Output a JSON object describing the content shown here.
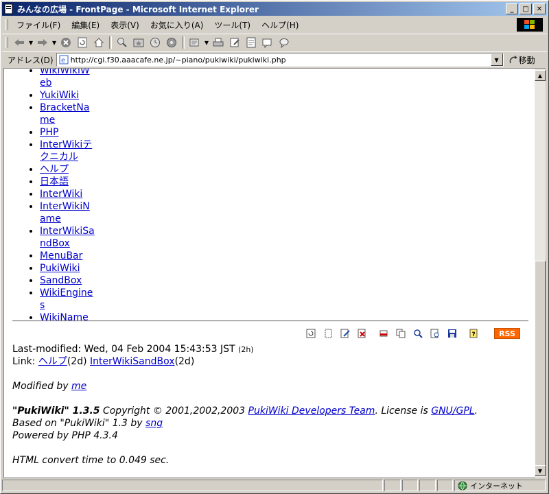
{
  "window": {
    "title": "みんなの広場 - FrontPage - Microsoft Internet Explorer"
  },
  "menu": {
    "items": [
      "ファイル(F)",
      "編集(E)",
      "表示(V)",
      "お気に入り(A)",
      "ツール(T)",
      "ヘルプ(H)"
    ]
  },
  "toolbar": {
    "buttons": [
      "back-icon",
      "forward-icon",
      "stop-icon",
      "refresh-icon",
      "home-icon",
      "search-icon",
      "favorites-icon",
      "history-icon",
      "mail-icon",
      "print-icon",
      "edit-icon",
      "discuss-icon",
      "messenger-icon"
    ]
  },
  "address": {
    "label": "アドレス(D)",
    "url": "http://cgi.f30.aaacafe.ne.jp/~piano/pukiwiki/pukiwiki.php",
    "go_label": "移動"
  },
  "page": {
    "links": [
      "WikiWikiWeb",
      "YukiWiki",
      "BracketName",
      "PHP",
      "InterWikiテクニカル",
      "ヘルプ",
      "日本語",
      "InterWiki",
      "InterWikiName",
      "InterWikiSandBox",
      "MenuBar",
      "PukiWiki",
      "SandBox",
      "WikiEngines",
      "WikiName"
    ],
    "rss_label": "RSS",
    "last_modified": "Last-modified: Wed, 04 Feb 2004 15:43:53 JST",
    "last_modified_age": "(2h)",
    "link_prefix": "Link:",
    "link_items": [
      {
        "text": "ヘルプ",
        "age": "(2d)"
      },
      {
        "text": "InterWikiSandBox",
        "age": "(2d)"
      }
    ],
    "modified_by_prefix": "Modified by",
    "modified_by_user": "me",
    "pukiwiki_name": "\"PukiWiki\" 1.3.5",
    "copyright_text": "Copyright © 2001,2002,2003",
    "dev_team_link": "PukiWiki Developers Team",
    "license_text": ". License is",
    "license_link": "GNU/GPL",
    "license_end": ".",
    "based_on_text": "Based on \"PukiWiki\" 1.3 by",
    "based_on_link": "sng",
    "powered_by": "Powered by PHP 4.3.4",
    "convert_time": "HTML convert time to 0.049 sec."
  },
  "status": {
    "zone_label": "インターネット"
  }
}
